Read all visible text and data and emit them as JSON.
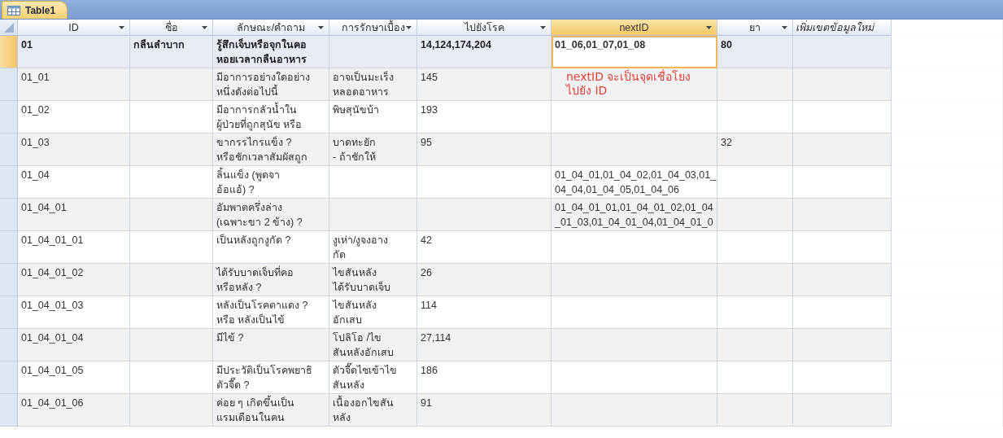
{
  "tabs": [
    {
      "label": "Table1",
      "selected": true
    }
  ],
  "columns": [
    {
      "label": "ID",
      "kind": "field",
      "selected": false
    },
    {
      "label": "ชื่อ",
      "kind": "field",
      "selected": false
    },
    {
      "label": "ลักษณะ/คำถาม",
      "kind": "field",
      "selected": false
    },
    {
      "label": "การรักษาเบื้อง",
      "kind": "field",
      "selected": false
    },
    {
      "label": "ไปยังโรค",
      "kind": "field",
      "selected": false
    },
    {
      "label": "nextID",
      "kind": "field",
      "selected": true
    },
    {
      "label": "ยา",
      "kind": "field",
      "selected": false
    },
    {
      "label": "เพิ่มเขตข้อมูลใหม่",
      "kind": "add_field",
      "selected": false
    }
  ],
  "rows": [
    {
      "selected": true,
      "cells": [
        "01",
        "กลืนลำบาก",
        "รู้สึกเจ็บหรือจุกในคอ\nหอยเวลากลืนอาหาร",
        null,
        "14,124,174,204",
        "01_06,01_07,01_08",
        "80",
        null
      ]
    },
    {
      "selected": false,
      "note": "nextID จะเป็นจุดเชื่อโยง\nไปยัง ID",
      "cells": [
        "01_01",
        null,
        "มีอาการอย่างใดอย่าง\nหนึ่งดังต่อไปนี้",
        "อาจเป็นมะเร็ง\nหลอดอาหาร",
        "145",
        null,
        null,
        null
      ]
    },
    {
      "selected": false,
      "cells": [
        "01_02",
        null,
        "มีอาการกลัวน้ำใน\nผู้ป่วยที่ถูกสุนัข หรือ",
        "พิษสุนัขบ้า",
        "193",
        null,
        null,
        null
      ]
    },
    {
      "selected": false,
      "cells": [
        "01_03",
        null,
        "ขากรรไกรแข็ง ?\nหรือชักเวลาสัมผัสถูก",
        "บาดทะยัก\n- ถ้าชักให้",
        "95",
        null,
        "32",
        null
      ]
    },
    {
      "selected": false,
      "cells": [
        "01_04",
        null,
        "ลิ้นแข็ง (พูดจา\nอ้อแอ้) ?",
        null,
        null,
        "01_04_01,01_04_02,01_04_03,01_\n04_04,01_04_05,01_04_06",
        null,
        null
      ]
    },
    {
      "selected": false,
      "cells": [
        "01_04_01",
        null,
        "อัมพาตครึ่งล่าง\n(เฉพาะขา 2 ข้าง) ?",
        null,
        null,
        "01_04_01_01,01_04_01_02,01_04\n_01_03,01_04_01_04,01_04_01_0",
        null,
        null
      ]
    },
    {
      "selected": false,
      "cells": [
        "01_04_01_01",
        null,
        "เป็นหลังถูกงูกัด ?",
        "งูเห่า/งูจงอาง\nกัด",
        "42",
        null,
        null,
        null
      ]
    },
    {
      "selected": false,
      "cells": [
        "01_04_01_02",
        null,
        "ได้รับบาดเจ็บที่คอ\nหรือหลัง ?",
        "ไขสันหลัง\nได้รับบาดเจ็บ",
        "26",
        null,
        null,
        null
      ]
    },
    {
      "selected": false,
      "cells": [
        "01_04_01_03",
        null,
        "หลังเป็นโรคตาแดง ?\nหรือ หลังเป็นไข้",
        "ไขสันหลัง\nอักเสบ",
        "114",
        null,
        null,
        null
      ]
    },
    {
      "selected": false,
      "cells": [
        "01_04_01_04",
        null,
        "มีไข้ ?",
        "โปลิโอ /ไข\nสันหลังอักเสบ",
        "27,114",
        null,
        null,
        null
      ]
    },
    {
      "selected": false,
      "cells": [
        "01_04_01_05",
        null,
        "มีประวัติเป็นโรคพยาธิ\nตัวจี๊ด ?",
        "ตัวจี๊ดไชเข้าไข\nสันหลัง",
        "186",
        null,
        null,
        null
      ]
    },
    {
      "selected": false,
      "cells": [
        "01_04_01_06",
        null,
        "ค่อย ๆ เกิดขึ้นเป็น\nแรมเดือนในคน",
        "เนื้องอกไขสัน\nหลัง",
        "91",
        null,
        null,
        null
      ]
    }
  ]
}
